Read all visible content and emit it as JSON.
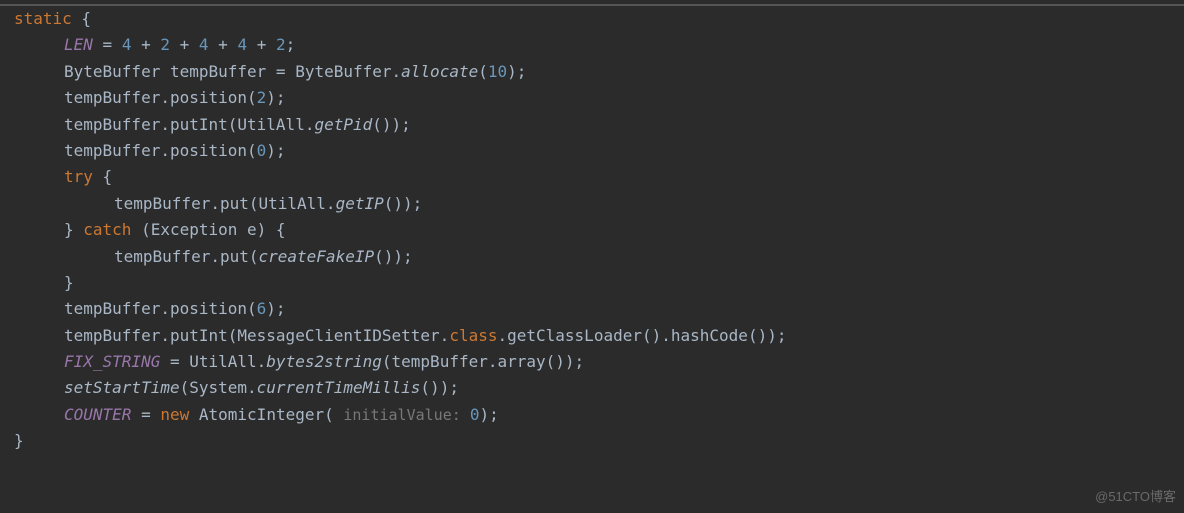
{
  "code": {
    "keywords": {
      "static": "static",
      "try": "try",
      "catch": "catch",
      "class": "class",
      "new": "new"
    },
    "fields": {
      "LEN": "LEN",
      "FIX_STRING": "FIX_STRING",
      "COUNTER": "COUNTER"
    },
    "line1_expr": " = 4 + 2 + 4 + 4 + 2;",
    "line2_a": "ByteBuffer tempBuffer = ByteBuffer.",
    "line2_b": "allocate",
    "line2_c": "(",
    "line2_num": "10",
    "line2_d": ");",
    "line3_a": "tempBuffer.position(",
    "line3_num": "2",
    "line3_b": ");",
    "line4_a": "tempBuffer.putInt(UtilAll.",
    "line4_b": "getPid",
    "line4_c": "());",
    "line5_a": "tempBuffer.position(",
    "line5_num": "0",
    "line5_b": ");",
    "line6_brace": " {",
    "line7_a": "tempBuffer.put(UtilAll.",
    "line7_b": "getIP",
    "line7_c": "());",
    "line8_a": "} ",
    "line8_b": " (Exception e) {",
    "line9_a": "tempBuffer.put(",
    "line9_b": "createFakeIP",
    "line9_c": "());",
    "line10": "}",
    "line11_a": "tempBuffer.position(",
    "line11_num": "6",
    "line11_b": ");",
    "line12_a": "tempBuffer.putInt(MessageClientIDSetter.",
    "line12_b": ".getClassLoader().hashCode());",
    "line13_a": " = UtilAll.",
    "line13_b": "bytes2string",
    "line13_c": "(tempBuffer.array());",
    "line14_a": "setStartTime",
    "line14_b": "(System.",
    "line14_c": "currentTimeMillis",
    "line14_d": "());",
    "line15_a": " = ",
    "line15_b": " AtomicInteger( ",
    "line15_hint": "initialValue: ",
    "line15_num": "0",
    "line15_c": ");",
    "line16": "}",
    "expr_numbers": {
      "n4a": "4",
      "n2a": "2",
      "n4b": "4",
      "n4c": "4",
      "n2b": "2"
    },
    "open_brace": " {"
  },
  "watermark": "@51CTO博客"
}
